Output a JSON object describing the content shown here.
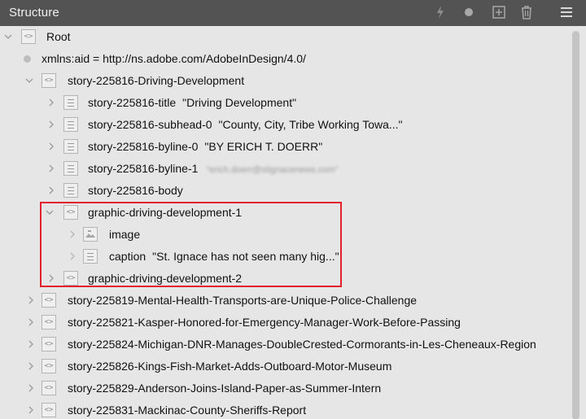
{
  "panel": {
    "title": "Structure"
  },
  "toolbar": {
    "icons": [
      "lightning-icon",
      "dot-icon",
      "add-icon",
      "trash-icon",
      "menu-icon"
    ]
  },
  "tree": {
    "root": {
      "label": "Root"
    },
    "xmlns": {
      "label": "xmlns:aid = http://ns.adobe.com/AdobeInDesign/4.0/"
    },
    "story1": {
      "label": "story-225816-Driving-Development"
    },
    "title_row": {
      "label": "story-225816-title",
      "value": "\"Driving Development\""
    },
    "subhead_row": {
      "label": "story-225816-subhead-0",
      "value": "\"County, City, Tribe Working Towa...\""
    },
    "byline0_row": {
      "label": "story-225816-byline-0",
      "value": "\"BY ERICH T. DOERR\""
    },
    "byline1_row": {
      "label": "story-225816-byline-1",
      "value": "\"erich.doerr@stignacenews.com\""
    },
    "body_row": {
      "label": "story-225816-body"
    },
    "graphic1": {
      "label": "graphic-driving-development-1"
    },
    "image_row": {
      "label": "image"
    },
    "caption_row": {
      "label": "caption",
      "value": "\"St. Ignace has not seen many hig...\""
    },
    "graphic2": {
      "label": "graphic-driving-development-2"
    },
    "stories": [
      {
        "label": "story-225819-Mental-Health-Transports-are-Unique-Police-Challenge"
      },
      {
        "label": "story-225821-Kasper-Honored-for-Emergency-Manager-Work-Before-Passing"
      },
      {
        "label": "story-225824-Michigan-DNR-Manages-DoubleCrested-Cormorants-in-Les-Cheneaux-Region"
      },
      {
        "label": "story-225826-Kings-Fish-Market-Adds-Outboard-Motor-Museum"
      },
      {
        "label": "story-225829-Anderson-Joins-Island-Paper-as-Summer-Intern"
      },
      {
        "label": "story-225831-Mackinac-County-Sheriffs-Report"
      }
    ]
  },
  "colors": {
    "header_bg": "#535353",
    "panel_bg": "#e6e6e6",
    "highlight": "#e3202e"
  }
}
